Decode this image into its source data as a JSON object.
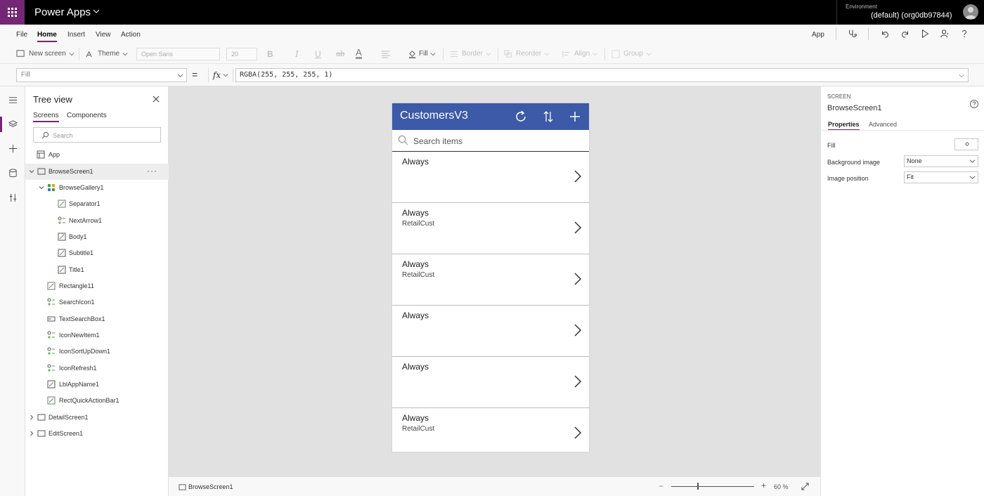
{
  "topbar": {
    "app_title": "Power Apps",
    "environment_label": "Environment",
    "environment_value": "(default) (org0db97844)"
  },
  "menu": {
    "items": [
      "File",
      "Home",
      "Insert",
      "View",
      "Action"
    ],
    "active": "Home",
    "app_label": "App"
  },
  "ribbon": {
    "new_screen": "New screen",
    "theme": "Theme",
    "font": "Open Sans",
    "font_size": "20",
    "fill": "Fill",
    "border": "Border",
    "reorder": "Reorder",
    "align": "Align",
    "group": "Group"
  },
  "formula": {
    "property": "Fill",
    "equals": "=",
    "fx": "fx",
    "value": "RGBA(255, 255, 255, 1)"
  },
  "treeview": {
    "title": "Tree view",
    "tabs": [
      "Screens",
      "Components"
    ],
    "search_placeholder": "Search",
    "items": [
      {
        "label": "App"
      },
      {
        "label": "BrowseScreen1"
      },
      {
        "label": "BrowseGallery1"
      },
      {
        "label": "Separator1"
      },
      {
        "label": "NextArrow1"
      },
      {
        "label": "Body1"
      },
      {
        "label": "Subtitle1"
      },
      {
        "label": "Title1"
      },
      {
        "label": "Rectangle11"
      },
      {
        "label": "SearchIcon1"
      },
      {
        "label": "TextSearchBox1"
      },
      {
        "label": "IconNewItem1"
      },
      {
        "label": "IconSortUpDown1"
      },
      {
        "label": "IconRefresh1"
      },
      {
        "label": "LblAppName1"
      },
      {
        "label": "RectQuickActionBar1"
      },
      {
        "label": "DetailScreen1"
      },
      {
        "label": "EditScreen1"
      }
    ]
  },
  "device": {
    "title": "CustomersV3",
    "search_placeholder": "Search items",
    "header_color": "#3c5aa8",
    "items": [
      {
        "title": "Always",
        "subtitle": ""
      },
      {
        "title": "Always",
        "subtitle": "RetailCust"
      },
      {
        "title": "Always",
        "subtitle": "RetailCust"
      },
      {
        "title": "Always",
        "subtitle": ""
      },
      {
        "title": "Always",
        "subtitle": ""
      },
      {
        "title": "Always",
        "subtitle": "RetailCust"
      }
    ]
  },
  "statusbar": {
    "screen": "BrowseScreen1",
    "zoom": "60 %",
    "zoom_percent": 60
  },
  "properties": {
    "type": "SCREEN",
    "name": "BrowseScreen1",
    "tabs": [
      "Properties",
      "Advanced"
    ],
    "fill_label": "Fill",
    "bg_image_label": "Background image",
    "bg_image_value": "None",
    "image_position_label": "Image position",
    "image_position_value": "Fit"
  },
  "colors": {
    "brand_purple": "#742774",
    "header_blue": "#3c5aa8"
  }
}
